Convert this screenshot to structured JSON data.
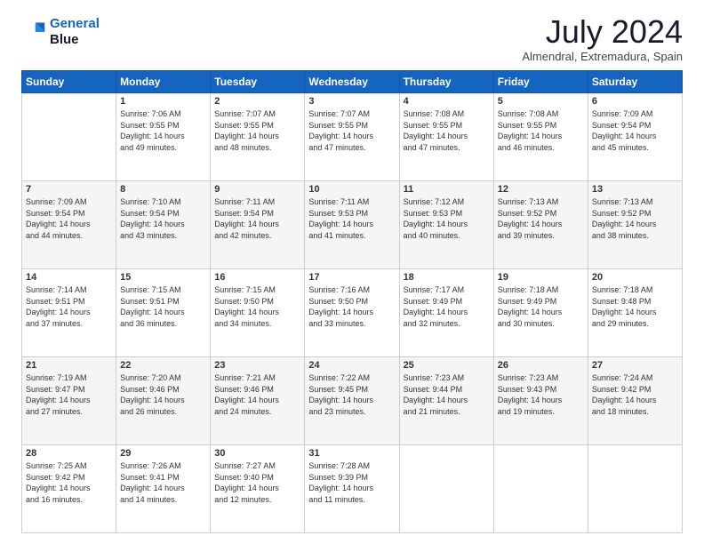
{
  "header": {
    "logo_line1": "General",
    "logo_line2": "Blue",
    "month_year": "July 2024",
    "location": "Almendral, Extremadura, Spain"
  },
  "weekdays": [
    "Sunday",
    "Monday",
    "Tuesday",
    "Wednesday",
    "Thursday",
    "Friday",
    "Saturday"
  ],
  "weeks": [
    [
      {
        "day": "",
        "info": ""
      },
      {
        "day": "1",
        "info": "Sunrise: 7:06 AM\nSunset: 9:55 PM\nDaylight: 14 hours\nand 49 minutes."
      },
      {
        "day": "2",
        "info": "Sunrise: 7:07 AM\nSunset: 9:55 PM\nDaylight: 14 hours\nand 48 minutes."
      },
      {
        "day": "3",
        "info": "Sunrise: 7:07 AM\nSunset: 9:55 PM\nDaylight: 14 hours\nand 47 minutes."
      },
      {
        "day": "4",
        "info": "Sunrise: 7:08 AM\nSunset: 9:55 PM\nDaylight: 14 hours\nand 47 minutes."
      },
      {
        "day": "5",
        "info": "Sunrise: 7:08 AM\nSunset: 9:55 PM\nDaylight: 14 hours\nand 46 minutes."
      },
      {
        "day": "6",
        "info": "Sunrise: 7:09 AM\nSunset: 9:54 PM\nDaylight: 14 hours\nand 45 minutes."
      }
    ],
    [
      {
        "day": "7",
        "info": "Sunrise: 7:09 AM\nSunset: 9:54 PM\nDaylight: 14 hours\nand 44 minutes."
      },
      {
        "day": "8",
        "info": "Sunrise: 7:10 AM\nSunset: 9:54 PM\nDaylight: 14 hours\nand 43 minutes."
      },
      {
        "day": "9",
        "info": "Sunrise: 7:11 AM\nSunset: 9:54 PM\nDaylight: 14 hours\nand 42 minutes."
      },
      {
        "day": "10",
        "info": "Sunrise: 7:11 AM\nSunset: 9:53 PM\nDaylight: 14 hours\nand 41 minutes."
      },
      {
        "day": "11",
        "info": "Sunrise: 7:12 AM\nSunset: 9:53 PM\nDaylight: 14 hours\nand 40 minutes."
      },
      {
        "day": "12",
        "info": "Sunrise: 7:13 AM\nSunset: 9:52 PM\nDaylight: 14 hours\nand 39 minutes."
      },
      {
        "day": "13",
        "info": "Sunrise: 7:13 AM\nSunset: 9:52 PM\nDaylight: 14 hours\nand 38 minutes."
      }
    ],
    [
      {
        "day": "14",
        "info": "Sunrise: 7:14 AM\nSunset: 9:51 PM\nDaylight: 14 hours\nand 37 minutes."
      },
      {
        "day": "15",
        "info": "Sunrise: 7:15 AM\nSunset: 9:51 PM\nDaylight: 14 hours\nand 36 minutes."
      },
      {
        "day": "16",
        "info": "Sunrise: 7:15 AM\nSunset: 9:50 PM\nDaylight: 14 hours\nand 34 minutes."
      },
      {
        "day": "17",
        "info": "Sunrise: 7:16 AM\nSunset: 9:50 PM\nDaylight: 14 hours\nand 33 minutes."
      },
      {
        "day": "18",
        "info": "Sunrise: 7:17 AM\nSunset: 9:49 PM\nDaylight: 14 hours\nand 32 minutes."
      },
      {
        "day": "19",
        "info": "Sunrise: 7:18 AM\nSunset: 9:49 PM\nDaylight: 14 hours\nand 30 minutes."
      },
      {
        "day": "20",
        "info": "Sunrise: 7:18 AM\nSunset: 9:48 PM\nDaylight: 14 hours\nand 29 minutes."
      }
    ],
    [
      {
        "day": "21",
        "info": "Sunrise: 7:19 AM\nSunset: 9:47 PM\nDaylight: 14 hours\nand 27 minutes."
      },
      {
        "day": "22",
        "info": "Sunrise: 7:20 AM\nSunset: 9:46 PM\nDaylight: 14 hours\nand 26 minutes."
      },
      {
        "day": "23",
        "info": "Sunrise: 7:21 AM\nSunset: 9:46 PM\nDaylight: 14 hours\nand 24 minutes."
      },
      {
        "day": "24",
        "info": "Sunrise: 7:22 AM\nSunset: 9:45 PM\nDaylight: 14 hours\nand 23 minutes."
      },
      {
        "day": "25",
        "info": "Sunrise: 7:23 AM\nSunset: 9:44 PM\nDaylight: 14 hours\nand 21 minutes."
      },
      {
        "day": "26",
        "info": "Sunrise: 7:23 AM\nSunset: 9:43 PM\nDaylight: 14 hours\nand 19 minutes."
      },
      {
        "day": "27",
        "info": "Sunrise: 7:24 AM\nSunset: 9:42 PM\nDaylight: 14 hours\nand 18 minutes."
      }
    ],
    [
      {
        "day": "28",
        "info": "Sunrise: 7:25 AM\nSunset: 9:42 PM\nDaylight: 14 hours\nand 16 minutes."
      },
      {
        "day": "29",
        "info": "Sunrise: 7:26 AM\nSunset: 9:41 PM\nDaylight: 14 hours\nand 14 minutes."
      },
      {
        "day": "30",
        "info": "Sunrise: 7:27 AM\nSunset: 9:40 PM\nDaylight: 14 hours\nand 12 minutes."
      },
      {
        "day": "31",
        "info": "Sunrise: 7:28 AM\nSunset: 9:39 PM\nDaylight: 14 hours\nand 11 minutes."
      },
      {
        "day": "",
        "info": ""
      },
      {
        "day": "",
        "info": ""
      },
      {
        "day": "",
        "info": ""
      }
    ]
  ]
}
